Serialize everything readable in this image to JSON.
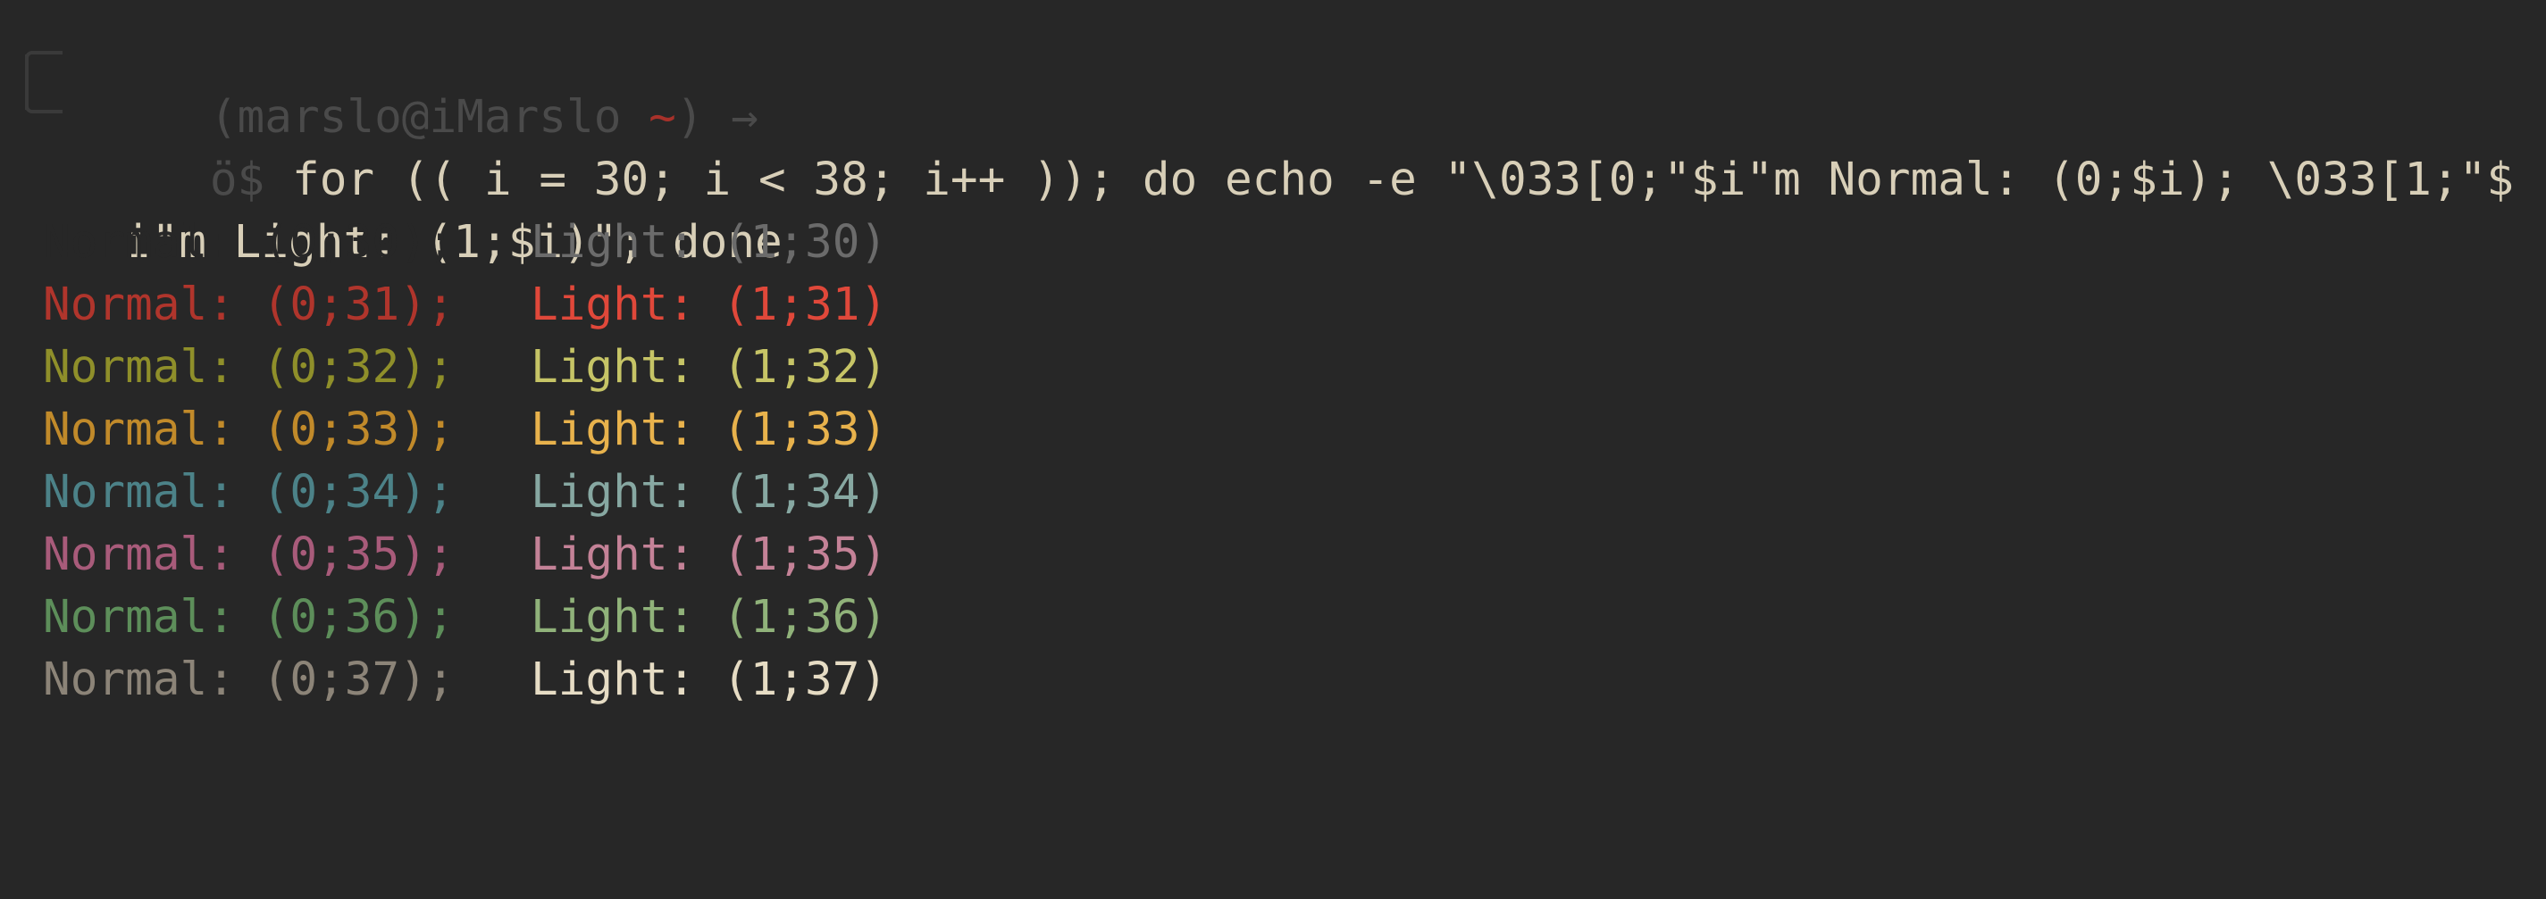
{
  "prompt": {
    "open_paren": "(",
    "user_host": "marslo@iMarslo",
    "path": "~",
    "close_paren": ")",
    "arrow": "→",
    "git_icon": "ö",
    "dollar": "$"
  },
  "command": {
    "line1": "for (( i = 30; i < 38; i++ )); do echo -e \"\\033[0;\"$i\"m Normal: (0;$i); \\033[1;\"$",
    "line2": "i\"m Light: (1;$i)\"; done"
  },
  "output": [
    {
      "normal": "Normal: (0;30);",
      "light": "Light: (1;30)",
      "normal_color": "#272727",
      "light_color": "#6b6b6b"
    },
    {
      "normal": "Normal: (0;31);",
      "light": "Light: (1;31)",
      "normal_color": "#b0352c",
      "light_color": "#e0483a"
    },
    {
      "normal": "Normal: (0;32);",
      "light": "Light: (1;32)",
      "normal_color": "#8f8f2a",
      "light_color": "#c6c466"
    },
    {
      "normal": "Normal: (0;33);",
      "light": "Light: (1;33)",
      "normal_color": "#c18a2a",
      "light_color": "#e8b24c"
    },
    {
      "normal": "Normal: (0;34);",
      "light": "Light: (1;34)",
      "normal_color": "#4c8288",
      "light_color": "#87a8a2"
    },
    {
      "normal": "Normal: (0;35);",
      "light": "Light: (1;35)",
      "normal_color": "#a85b7a",
      "light_color": "#c48297"
    },
    {
      "normal": "Normal: (0;36);",
      "light": "Light: (1;36)",
      "normal_color": "#5d8e5a",
      "light_color": "#90b27a"
    },
    {
      "normal": "Normal: (0;37);",
      "light": "Light: (1;37)",
      "normal_color": "#8c8478",
      "light_color": "#e6dcc4"
    }
  ]
}
